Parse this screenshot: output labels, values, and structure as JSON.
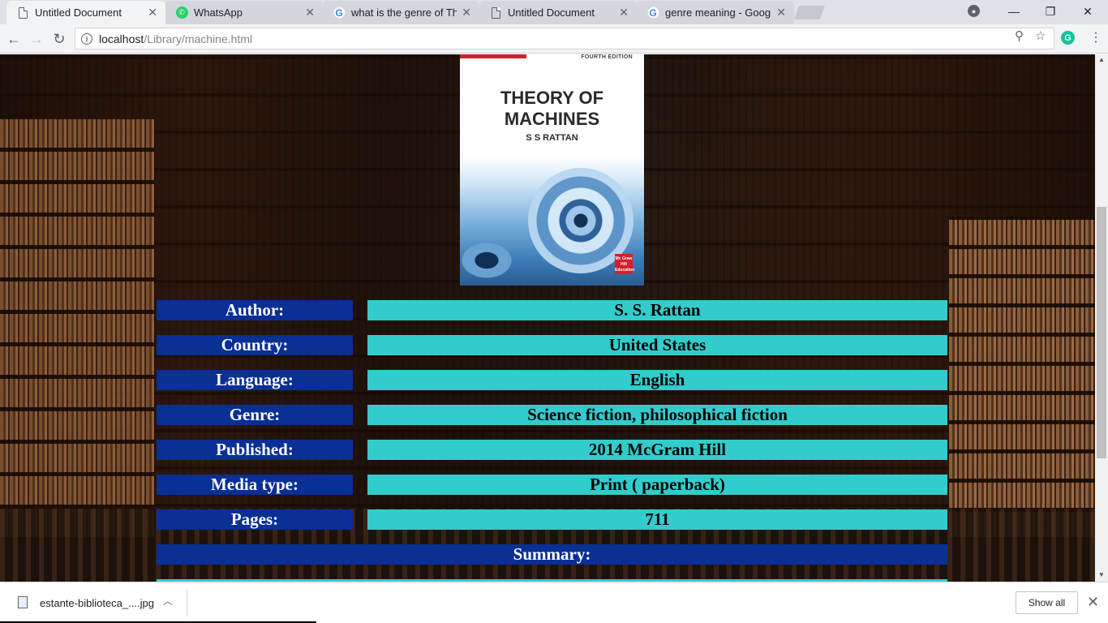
{
  "browser": {
    "tabs": [
      {
        "title": "Untitled Document",
        "icon": "document-icon",
        "active": true
      },
      {
        "title": "WhatsApp",
        "icon": "whatsapp-icon",
        "active": false
      },
      {
        "title": "what is the genre of Theo",
        "icon": "google-icon",
        "active": false
      },
      {
        "title": "Untitled Document",
        "icon": "document-icon",
        "active": false
      },
      {
        "title": "genre meaning - Google",
        "icon": "google-icon",
        "active": false
      }
    ],
    "url_host": "localhost",
    "url_path": "/Library/machine.html"
  },
  "book": {
    "cover": {
      "edition": "FOURTH EDITION",
      "title_line1": "THEORY OF",
      "title_line2": "MACHINES",
      "author": "S S RATTAN",
      "publisher_logo": "Mc Graw Hill Education"
    },
    "rows": [
      {
        "label": "Author:",
        "value": "S. S. Rattan"
      },
      {
        "label": "Country:",
        "value": "United States"
      },
      {
        "label": "Language:",
        "value": "English"
      },
      {
        "label": "Genre:",
        "value": "Science fiction, philosophical fiction"
      },
      {
        "label": "Published:",
        "value": "2014 McGram Hill"
      },
      {
        "label": "Media type:",
        "value": "Print ( paperback)"
      },
      {
        "label": "Pages:",
        "value": "711"
      }
    ],
    "summary_label": "Summary:"
  },
  "downloads": {
    "file_name": "estante-biblioteca_....jpg",
    "show_all_label": "Show all"
  },
  "colors": {
    "label_bg": "#0a2f95",
    "value_bg": "#33cccc"
  }
}
